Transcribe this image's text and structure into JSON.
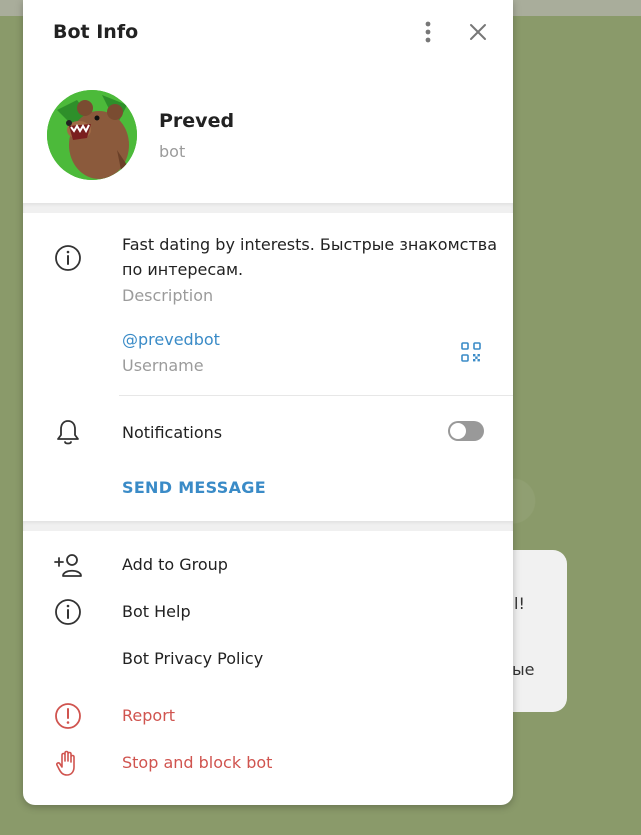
{
  "header": {
    "title": "Bot Info"
  },
  "profile": {
    "name": "Preved",
    "subtitle": "bot"
  },
  "info": {
    "description_line1": "Fast dating by interests. Быстрые знакомства",
    "description_line2": "по интересам.",
    "description_label": "Description",
    "username": "@prevedbot",
    "username_label": "Username"
  },
  "notifications": {
    "label": "Notifications",
    "enabled": false
  },
  "send_message": "SEND MESSAGE",
  "actions": [
    {
      "label": "Add to Group",
      "icon": "add-user-icon"
    },
    {
      "label": "Bot Help",
      "icon": "info-icon"
    },
    {
      "label": "Bot Privacy Policy",
      "icon": ""
    },
    {
      "label": "Report",
      "icon": "report-icon"
    },
    {
      "label": "Stop and block bot",
      "icon": "hand-stop-icon"
    }
  ],
  "background_chat": {
    "line1": "l!",
    "line2": "ые"
  },
  "colors": {
    "accent": "#3a8bc7",
    "danger": "#d0544f",
    "avatar_bg": "#4cba3a"
  }
}
